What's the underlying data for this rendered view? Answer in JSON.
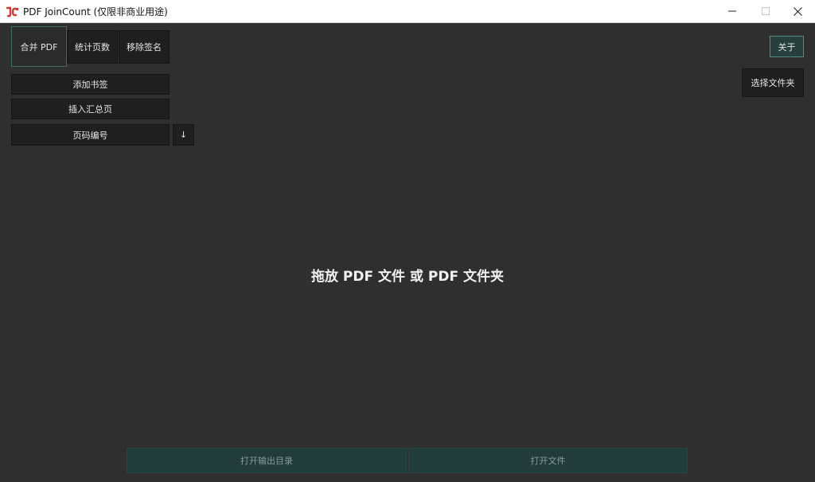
{
  "window": {
    "title": "PDF JoinCount (仅限非商业用途)"
  },
  "tabs": [
    {
      "label": "合并 PDF",
      "active": true
    },
    {
      "label": "统计页数",
      "active": false
    },
    {
      "label": "移除签名",
      "active": false
    }
  ],
  "options": {
    "add_bookmarks": "添加书签",
    "insert_summary": "插入汇总页",
    "page_numbering": "页码编号",
    "page_numbering_arrow": "↓"
  },
  "right": {
    "about": "关于",
    "choose_folder": "选择文件夹"
  },
  "main": {
    "drop_hint": "拖放 PDF 文件 或 PDF 文件夹"
  },
  "bottom": {
    "open_output_dir": "打开输出目录",
    "open_file": "打开文件"
  },
  "colors": {
    "background": "#2f2f2f",
    "button": "#1f1f1f",
    "accent_border": "#4e8c84",
    "bottom_button": "#213c3b"
  },
  "icons": {
    "app": "app-logo-icon",
    "minimize": "minimize-icon",
    "maximize": "maximize-icon",
    "close": "close-icon"
  }
}
